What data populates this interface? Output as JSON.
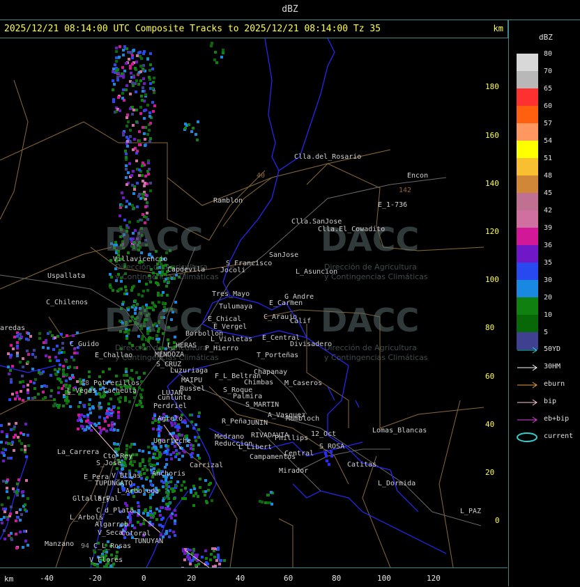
{
  "header": {
    "title": "dBZ"
  },
  "subheader": {
    "title": "2025/12/21 08:14:00 UTC Composite Tracks to 2025/12/21 08:14:00 Tz 35",
    "unit": "km"
  },
  "axes": {
    "x_unit": "km",
    "x_ticks": [
      "-40",
      "-20",
      "0",
      "20",
      "40",
      "60",
      "80",
      "100",
      "120"
    ],
    "y_ticks": [
      "180",
      "160",
      "140",
      "120",
      "100",
      "80",
      "60",
      "40",
      "20",
      "0"
    ]
  },
  "legend": {
    "title": "dBZ",
    "levels": [
      {
        "label": "80",
        "color": "#d8d8d8"
      },
      {
        "label": "70",
        "color": "#b8b8b8"
      },
      {
        "label": "65",
        "color": "#ff3030"
      },
      {
        "label": "60",
        "color": "#ff6010"
      },
      {
        "label": "57",
        "color": "#ff9860"
      },
      {
        "label": "54",
        "color": "#ffff00"
      },
      {
        "label": "51",
        "color": "#f8c030"
      },
      {
        "label": "48",
        "color": "#d08838"
      },
      {
        "label": "45",
        "color": "#c07090"
      },
      {
        "label": "42",
        "color": "#d070a0"
      },
      {
        "label": "39",
        "color": "#d01898"
      },
      {
        "label": "36",
        "color": "#7018c8"
      },
      {
        "label": "35",
        "color": "#2848f0"
      },
      {
        "label": "30",
        "color": "#1888e0"
      },
      {
        "label": "20",
        "color": "#108010"
      },
      {
        "label": "10",
        "color": "#086808"
      },
      {
        "label": "5",
        "color": "#404090"
      }
    ],
    "tracks": [
      {
        "label": "50YD",
        "color": "#30d0d0",
        "icon": "arrow-icon"
      },
      {
        "label": "30HM",
        "color": "#ffffff",
        "icon": "arrow-icon"
      },
      {
        "label": "eburn",
        "color": "#e8a040",
        "icon": "arrow-icon"
      },
      {
        "label": "bip",
        "color": "#ffc8d0",
        "icon": "arrow-icon"
      },
      {
        "label": "eb+bip",
        "color": "#e040e0",
        "icon": "arrow-icon"
      },
      {
        "label": "current",
        "color": "#30d0d0",
        "icon": "ellipse-icon"
      }
    ]
  },
  "watermark": {
    "brand": "DACC",
    "line1": "Dirección de Agricultura",
    "line2": "y Contingencias Climáticas"
  },
  "places": [
    "Clla.del_Rosario",
    "Encon",
    "142",
    "E_1-736",
    "Ramblon",
    "40",
    "Clla.SanJose",
    "Clla.El_Cowadito",
    "Villavicencio",
    "Uspallata",
    "S_Francisco",
    "SanJose",
    "L_Asuncion",
    "Capdevila",
    "Jocoli",
    "C_Chilenos",
    "Tres_Mayo",
    "Tulumaya",
    "G_Andre",
    "E_Carmen",
    "aredas",
    "E_Chical",
    "E_Vergel",
    "C_Araujo",
    "Calif",
    "Borbollon",
    "L_Violetas",
    "E_Central",
    "Divisadero",
    "C_Guido",
    "E_Challao",
    "L_HERAS",
    "P_Hierro",
    "MENDOZA",
    "T_Porteñas",
    "S_CRUZ",
    "Luzuriaga",
    "F_L_Beltran",
    "Chapanay",
    "MAIPU",
    "Chimbas",
    "M_Caseros",
    "88",
    "Potrerillos",
    "Russel",
    "S_Roque",
    "L_Vegas",
    "Cacheuta",
    "LUJAN",
    "Palmira",
    "Cunlunta",
    "S_MARTIN",
    "Perdriel",
    "A_Vasquez",
    "Mumbloch",
    "Agrelo",
    "R_Peña",
    "JUNIN",
    "Lomas_Blancas",
    "12_Oct",
    "Ugarteche",
    "Medrano",
    "RIVADAVIA",
    "Phillips",
    "Reduccion",
    "L_Libert",
    "S_ROSA",
    "La_Carrera",
    "Cto_Rey",
    "Campamentos",
    "Central",
    "S_Jose",
    "Carrizal",
    "Catitas",
    "E_Pera",
    "V_Btias",
    "Anchoris",
    "Mirador",
    "TUPUNGATO",
    "L_Dormida",
    "L_Arboleda",
    "Gltallary",
    "E_Pal",
    "C_d_Plata",
    "L_Arbols",
    "L_PAZ",
    "Algarrob",
    "V_Seca",
    "Cotoral",
    "Manzano",
    "94",
    "C_L_Rosas",
    "TUNUYAN",
    "V_Flores"
  ]
}
